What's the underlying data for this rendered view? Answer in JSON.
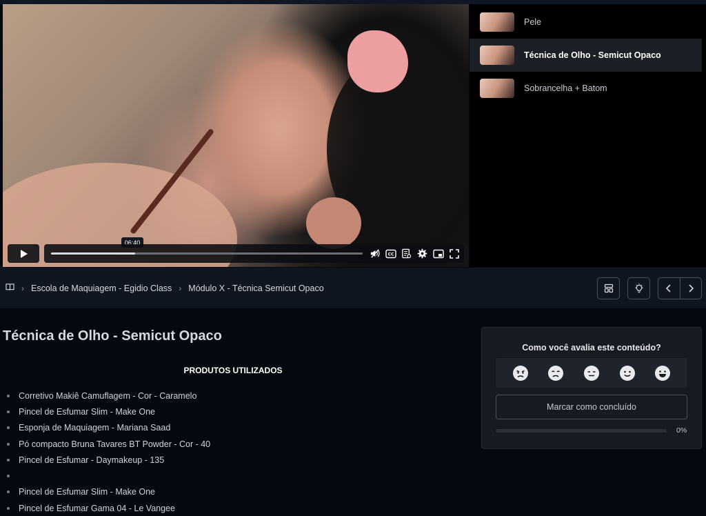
{
  "video": {
    "tooltip_time": "06:40",
    "progress": 0.27
  },
  "playlist": {
    "items": [
      {
        "label": "Pele",
        "active": false
      },
      {
        "label": "Técnica de Olho - Semicut Opaco",
        "active": true
      },
      {
        "label": "Sobrancelha + Batom",
        "active": false
      }
    ]
  },
  "breadcrumb": {
    "items": [
      "Escola de Maquiagem - Egidio Class",
      "Módulo X - Técnica Semicut Opaco"
    ]
  },
  "content": {
    "title": "Técnica de Olho - Semicut Opaco",
    "section_heading": "PRODUTOS UTILIZADOS",
    "products": [
      "Corretivo Makiê Camuflagem - Cor - Caramelo",
      "Pincel de Esfumar Slim - Make One",
      "Esponja de Maquiagem - Mariana Saad",
      "Pó compacto Bruna Tavares BT Powder - Cor - 40",
      "Pincel de Esfumar - Daymakeup - 135",
      "",
      "Pincel de Esfumar Slim - Make One",
      "Pincel de Esfumar Gama 04 - Le Vangee"
    ]
  },
  "rating": {
    "question": "Como você avalia este conteúdo?",
    "emojis": [
      "angry-face-icon",
      "sad-face-icon",
      "neutral-face-icon",
      "happy-face-icon",
      "grinning-face-icon"
    ],
    "mark_complete_label": "Marcar como concluído",
    "progress_percent": 0,
    "progress_label": "0%"
  },
  "colors": {
    "background": "#05090f",
    "panel": "#161a21",
    "active_item": "#1c1f26"
  }
}
